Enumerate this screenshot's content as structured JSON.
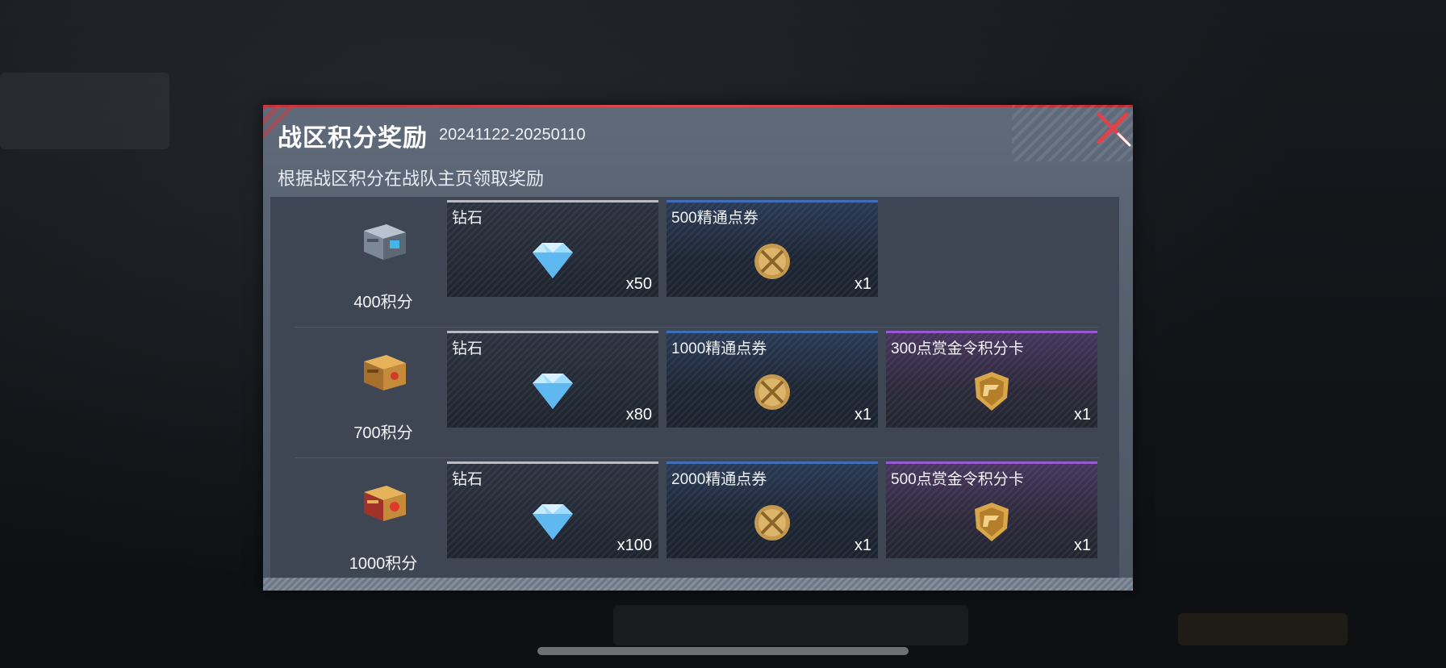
{
  "dialog": {
    "title": "战区积分奖励",
    "date_range": "20241122-20250110",
    "subtitle": "根据战区积分在战队主页领取奖励"
  },
  "colors": {
    "accent_red": "#e04850",
    "white_tier": "#b8bcc2",
    "blue_tier": "#3f6fb8",
    "purple_tier": "#9a58d0"
  },
  "tiers": [
    {
      "label": "400积分",
      "icon": "silver-chest-icon",
      "rewards": [
        {
          "name": "钻石",
          "qty": "x50",
          "icon": "diamond-icon",
          "rarity": "white"
        },
        {
          "name": "500精通点券",
          "qty": "x1",
          "icon": "mastery-coin-icon",
          "rarity": "blue"
        }
      ]
    },
    {
      "label": "700积分",
      "icon": "gold-chest-icon",
      "rewards": [
        {
          "name": "钻石",
          "qty": "x80",
          "icon": "diamond-icon",
          "rarity": "white"
        },
        {
          "name": "1000精通点券",
          "qty": "x1",
          "icon": "mastery-coin-icon",
          "rarity": "blue"
        },
        {
          "name": "300点赏金令积分卡",
          "qty": "x1",
          "icon": "bounty-badge-icon",
          "rarity": "purple"
        }
      ]
    },
    {
      "label": "1000积分",
      "icon": "gold-red-chest-icon",
      "rewards": [
        {
          "name": "钻石",
          "qty": "x100",
          "icon": "diamond-icon",
          "rarity": "white"
        },
        {
          "name": "2000精通点券",
          "qty": "x1",
          "icon": "mastery-coin-icon",
          "rarity": "blue"
        },
        {
          "name": "500点赏金令积分卡",
          "qty": "x1",
          "icon": "bounty-badge-icon",
          "rarity": "purple"
        }
      ]
    }
  ]
}
